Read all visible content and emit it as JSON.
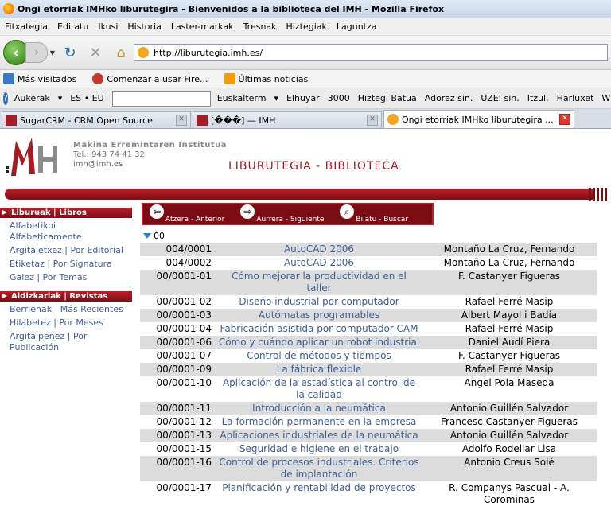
{
  "window": {
    "title": "Ongi etorriak IMHko liburutegira - Bienvenidos a la biblioteca del IMH - Mozilla Firefox"
  },
  "menu": [
    "Fitxategia",
    "Editatu",
    "Ikusi",
    "Historia",
    "Laster-markak",
    "Tresnak",
    "Hiztegiak",
    "Laguntza"
  ],
  "nav": {
    "url": "http://liburutegia.imh.es/"
  },
  "bookmarks": [
    "Más visitados",
    "Comenzar a usar Fire...",
    "Últimas noticias"
  ],
  "toolbar2": {
    "items": [
      "Aukerak",
      "ES • EU",
      "Euskalterm",
      "Elhuyar",
      "3000",
      "Hiztegi Batua",
      "Adorez sin.",
      "UZEI sin.",
      "Itzul.",
      "Harluxet",
      "Wik"
    ]
  },
  "tabs": [
    "SugarCRM - CRM Open Source",
    "[���] — IMH",
    "Ongi etorriak IMHko liburutegira ..."
  ],
  "header": {
    "inst_name": "Makina Erremintaren Institutua",
    "tel": "Tel.: 943 74 41 32",
    "email": "imh@imh.es",
    "title": "LIBURUTEGIA - BIBLIOTECA"
  },
  "sidebar": {
    "sec1": "Liburuak | Libros",
    "links1": [
      "Alfabetikoi | Alfabeticamente",
      "Argitaletxez | Por Editorial",
      "Etiketaz | Por Signatura",
      "Gaiez | Por Temas"
    ],
    "sec2": "Aldizkariak | Revistas",
    "links2": [
      "Berrienak | Más Recientes",
      "Hilabetez | Por Meses",
      "Argitalpenez | Por Publicación"
    ]
  },
  "buttons": [
    "Atzera - Anterior",
    "Aurrera - Siguiente",
    "Bilatu - Buscar"
  ],
  "group": "00",
  "rows": [
    [
      "004/0001",
      "AutoCAD 2006",
      "Montaño La Cruz, Fernando"
    ],
    [
      "004/0002",
      "AutoCAD 2006",
      "Montaño La Cruz, Fernando"
    ],
    [
      "00/0001-01",
      "Cómo mejorar la productividad en el taller",
      "F. Castanyer Figueras"
    ],
    [
      "00/0001-02",
      "Diseño industrial por computador",
      "Rafael Ferré Masip"
    ],
    [
      "00/0001-03",
      "Autómatas programables",
      "Albert Mayol i Badía"
    ],
    [
      "00/0001-04",
      "Fabricación asistida por computador CAM",
      "Rafael Ferré Masip"
    ],
    [
      "00/0001-06",
      "Cómo y cuándo aplicar un robot industrial",
      "Daniel Audí Piera"
    ],
    [
      "00/0001-07",
      "Control de métodos y tiempos",
      "F. Castanyer Figueras"
    ],
    [
      "00/0001-09",
      "La fábrica flexible",
      "Rafael Ferré Masip"
    ],
    [
      "00/0001-10",
      "Aplicación de la estadística al control de la calidad",
      "Angel Pola Maseda"
    ],
    [
      "00/0001-11",
      "Introducción a la neumática",
      "Antonio Guillén Salvador"
    ],
    [
      "00/0001-12",
      "La formación permanente en la empresa",
      "Francesc Castanyer Figueras"
    ],
    [
      "00/0001-13",
      "Aplicaciones industriales de la neumática",
      "Antonio Guillén Salvador"
    ],
    [
      "00/0001-15",
      "Seguridad e higiene en el trabajo",
      "Adolfo Rodellar Lisa"
    ],
    [
      "00/0001-16",
      "Control de procesos industriales. Criterios de implantación",
      "Antonio Creus Solé"
    ],
    [
      "00/0001-17",
      "Planificación y rentabilidad de proyectos",
      "R. Companys Pascual - A. Corominas"
    ]
  ]
}
